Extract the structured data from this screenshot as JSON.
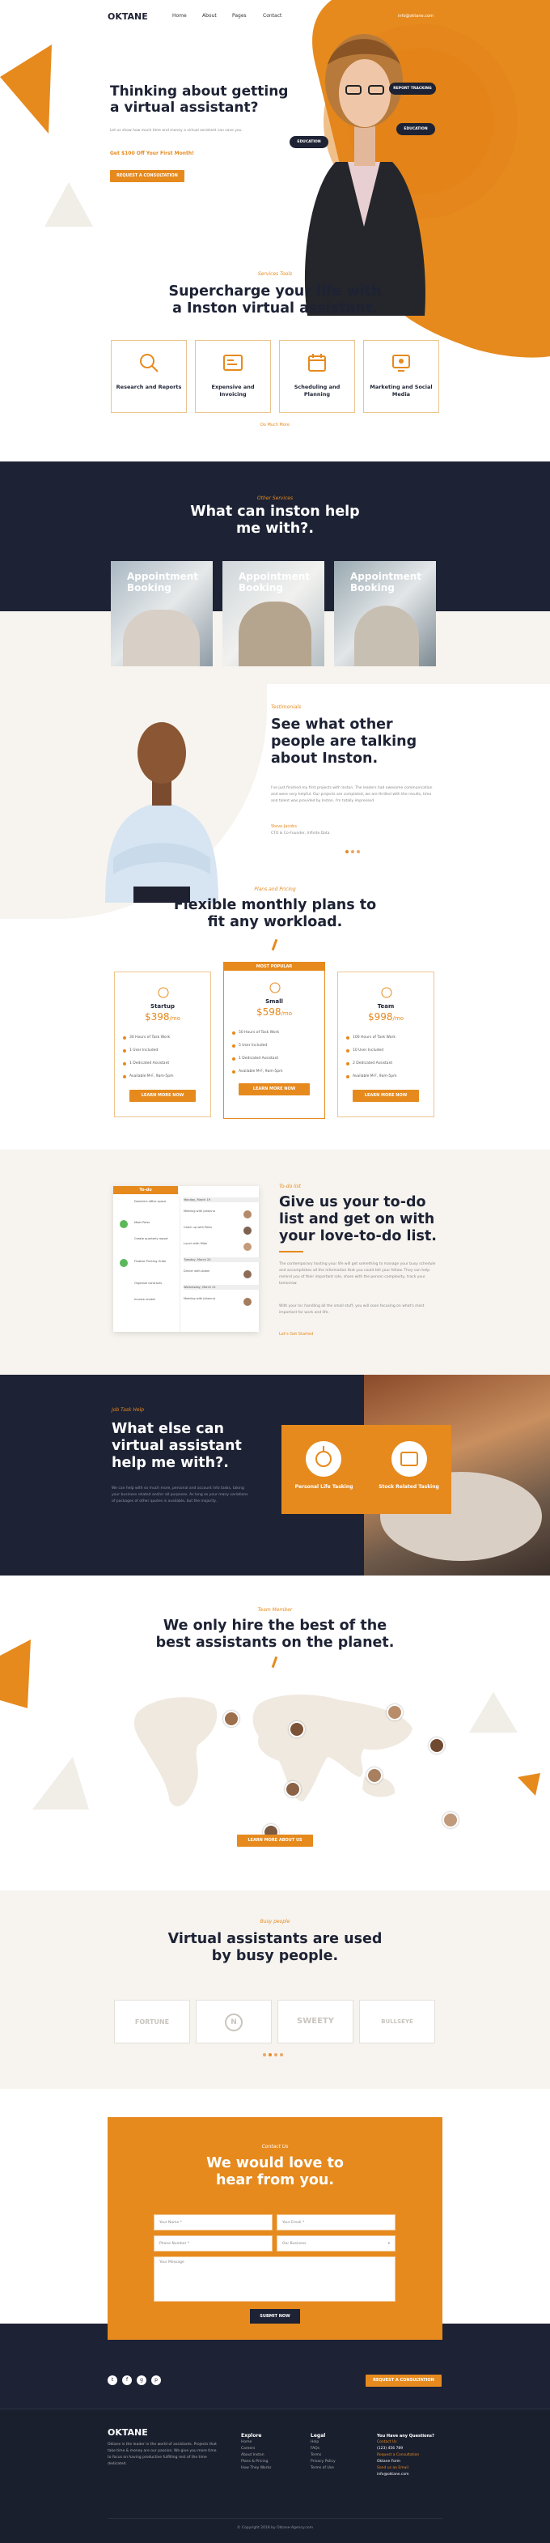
{
  "header": {
    "logo": "OKTANE",
    "nav": [
      "Home",
      "About",
      "Pages",
      "Contact"
    ],
    "topright": "info@oktane.com"
  },
  "hero": {
    "title": "Thinking about getting a virtual assistant?",
    "body": "Let us show how much time and money a virtual assistant can save you.",
    "offer": "Get $100 Off Your First Month!",
    "cta": "REQUEST A CONSULTATION",
    "badges": [
      "REPORT TRACKING",
      "EDUCATION",
      "EDUCATION"
    ]
  },
  "services": {
    "kicker": "Services Tools",
    "title": "Supercharge your life with a Inston virtual assistant.",
    "items": [
      "Research and Reports",
      "Expensive and Invoicing",
      "Scheduling and Planning",
      "Marketing and Social Media"
    ],
    "more": "Do Much More"
  },
  "help": {
    "kicker": "Other Services",
    "title": "What can inston help me with?.",
    "items": [
      "Appointment Booking",
      "Appointment Booking",
      "Appointment Booking"
    ]
  },
  "testimonial": {
    "kicker": "Testimonials",
    "title": "See what other people are talking about Inston.",
    "quote": "I've just finished my first projects with Inston. The leaders had awesome communication and were very helpful. Our projects are completed, we are thrilled with the results, time and talent was provided by Inston. I'm totally impressed.",
    "name": "Steve Jacobs",
    "role": "CTO & Co-Founder, Infinite Data"
  },
  "pricing": {
    "kicker": "Plans and Pricing",
    "title": "Flexible monthly plans to fit any workload.",
    "badge": "MOST POPULAR",
    "plans": [
      {
        "name": "Startup",
        "price": "$398",
        "per": "/mo",
        "features": [
          "30 Hours of Task Work",
          "1 User Included",
          "1 Dedicated Assistant",
          "Available M-F, 9am-5pm"
        ],
        "cta": "LEARN MORE NOW"
      },
      {
        "name": "Small",
        "price": "$598",
        "per": "/mo",
        "features": [
          "50 Hours of Task Work",
          "5 User Included",
          "1 Dedicated Assistant",
          "Available M-F, 9am-5pm"
        ],
        "cta": "LEARN MORE NOW"
      },
      {
        "name": "Team",
        "price": "$998",
        "per": "/mo",
        "features": [
          "100 Hours of Task Work",
          "10 User Included",
          "2 Dedicated Assistant",
          "Available M-F, 9am-5pm"
        ],
        "cta": "LEARN MORE NOW"
      }
    ]
  },
  "todo": {
    "kicker": "To-do list",
    "title": "Give us your to-do list and get on with your love-to-do list.",
    "p1": "The contemporary hosting your life will get something to manage your busy schedule and accomplishes all the information that you could tell your fellow. They can help remind you of their important role, share with the person complexity, track your tomorrow.",
    "p2": "With your Inc handling all the small stuff, you will soon focusing on what's most important for work and life.",
    "link": "Let's Get Started",
    "app": {
      "header": "To-do",
      "col1": [
        "Daniela's office space",
        "Meet Peter",
        "Create quarterly report",
        "Finalize Printing Order",
        "Organize contracts",
        "Invoice review"
      ],
      "col2": [
        "Monday, March 19",
        "Meeting with Johanna",
        "Catch up with Peter",
        "Lunch with Mike",
        "Tuesday, March 20",
        "Dinner with Adam",
        "Wednesday, March 21",
        "Meeting with Johanna"
      ]
    }
  },
  "personal": {
    "kicker": "Job Task Help",
    "title": "What else can virtual assistant help me with?.",
    "body": "We can help with so much more, personal and account info tasks, taking your business related and/or all purposes. As long as your many variations of packages of other quotes is available, but the majority.",
    "tiles": [
      "Personal Life Tasking",
      "Stock Related Tasking"
    ]
  },
  "team": {
    "kicker": "Team Member",
    "title": "We only hire the best of the best assistants on the planet.",
    "cta": "LEARN MORE ABOUT US"
  },
  "clients": {
    "kicker": "Busy people",
    "title": "Virtual assistants are used by busy people.",
    "logos": [
      "FORTUNE",
      "N",
      "SWEETY",
      "BULLSEYE"
    ]
  },
  "contact": {
    "kicker": "Contact Us",
    "title": "We would love to hear from you.",
    "fields": [
      "Your Name *",
      "Your Email *",
      "Phone Number *",
      "Our Business"
    ],
    "message": "Your Message",
    "submit": "SUBMIT NOW"
  },
  "footerbar": {
    "social": [
      "t",
      "f",
      "g",
      "p"
    ],
    "cta": "REQUEST A CONSULTATION"
  },
  "footer": {
    "logo": "OKTANE",
    "about": "Oktane is the leader in the world of assistants. Projects that take time & money are our passion. We give you more time to focus on having productive fulfilling rest of the time dedicated.",
    "cols": [
      {
        "title": "Explore",
        "items": [
          "Home",
          "Careers",
          "About Inston",
          "Plans & Pricing",
          "How They Works"
        ]
      },
      {
        "title": "Legal",
        "items": [
          "Help",
          "FAQs",
          "Terms",
          "Privacy Policy",
          "Terms of Use"
        ]
      },
      {
        "title": "You Have any Questions?",
        "items": [
          "Contact Us",
          "(123) 456 789",
          "Request a Consultation",
          "Oktane Form",
          "Send us an Email",
          "info@oktane.com"
        ]
      }
    ],
    "copyright": "© Copyright 2018 by Oktane-Agency.com"
  }
}
